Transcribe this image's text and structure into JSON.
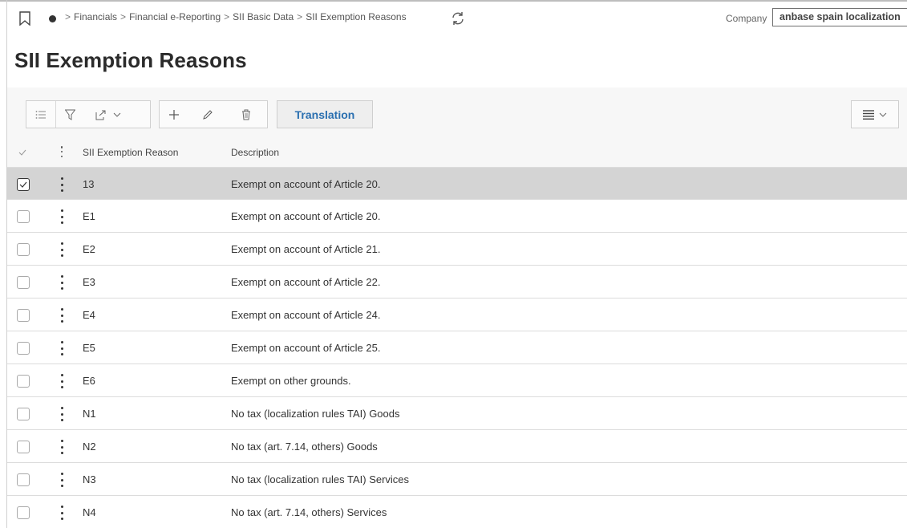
{
  "nav": {
    "breadcrumbs": [
      "Financials",
      "Financial e-Reporting",
      "SII Basic Data",
      "SII Exemption Reasons"
    ],
    "company_label": "Company",
    "company_value": "anbase spain localization"
  },
  "page": {
    "title": "SII Exemption Reasons"
  },
  "toolbar": {
    "translation_label": "Translation"
  },
  "table": {
    "columns": [
      "SII Exemption Reason",
      "Description"
    ],
    "rows": [
      {
        "code": "13",
        "description": "Exempt on account of Article 20.",
        "selected": true
      },
      {
        "code": "E1",
        "description": "Exempt on account of Article 20.",
        "selected": false
      },
      {
        "code": "E2",
        "description": "Exempt on account of Article 21.",
        "selected": false
      },
      {
        "code": "E3",
        "description": "Exempt on account of Article 22.",
        "selected": false
      },
      {
        "code": "E4",
        "description": "Exempt on account of Article 24.",
        "selected": false
      },
      {
        "code": "E5",
        "description": "Exempt on account of Article 25.",
        "selected": false
      },
      {
        "code": "E6",
        "description": "Exempt on other grounds.",
        "selected": false
      },
      {
        "code": "N1",
        "description": "No tax (localization rules TAI) Goods",
        "selected": false
      },
      {
        "code": "N2",
        "description": "No tax (art. 7.14, others) Goods",
        "selected": false
      },
      {
        "code": "N3",
        "description": "No tax (localization rules TAI) Services",
        "selected": false
      },
      {
        "code": "N4",
        "description": "No tax (art. 7.14, others) Services",
        "selected": false
      }
    ]
  },
  "icons": {
    "bookmark": "bookmark-icon",
    "home": "home-dot-icon",
    "refresh": "refresh-icon",
    "list": "list-icon",
    "filter": "filter-icon",
    "export": "export-icon",
    "add": "plus-icon",
    "edit": "pencil-icon",
    "delete": "trash-icon",
    "view": "table-view-icon"
  },
  "colors": {
    "accent": "#2a6fb0",
    "selected_row": "#d4d4d4",
    "panel_bg": "#f7f7f7"
  }
}
